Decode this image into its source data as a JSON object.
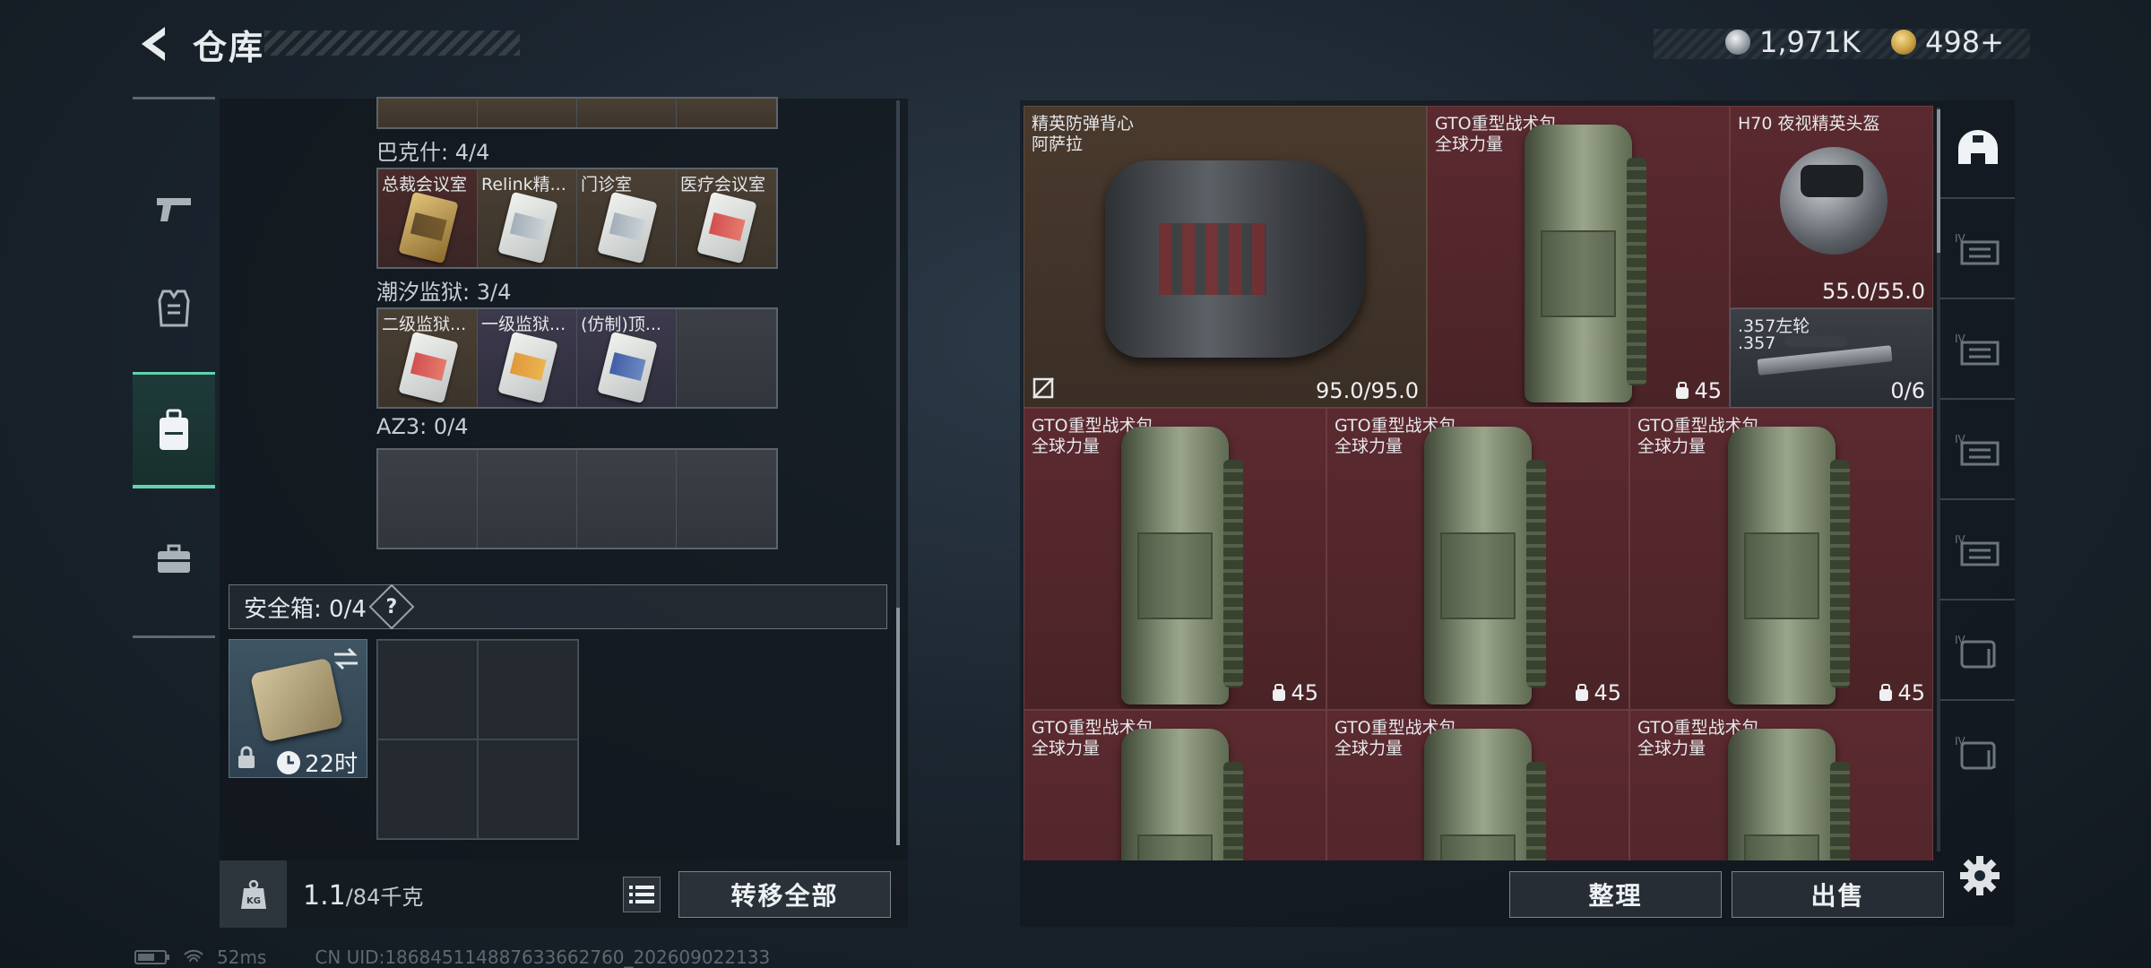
{
  "header": {
    "title": "仓库"
  },
  "currency": [
    {
      "icon": "silver-coin-icon",
      "amount": "1,971K"
    },
    {
      "icon": "gold-coin-icon",
      "amount": "498+"
    }
  ],
  "left_nav": [
    {
      "name": "weapons",
      "icon": "pistol-icon",
      "active": false
    },
    {
      "name": "gear",
      "icon": "armor-vest-icon",
      "active": false
    },
    {
      "name": "containers",
      "icon": "backpack-icon",
      "active": true
    },
    {
      "name": "supplies",
      "icon": "briefcase-icon",
      "active": false
    }
  ],
  "key_groups": [
    {
      "label": "巴克什: 4/4",
      "slots": [
        {
          "label": "总裁会议室",
          "style": "red",
          "card": "gold"
        },
        {
          "label": "Relink精...",
          "style": "tan",
          "card": "white"
        },
        {
          "label": "门诊室",
          "style": "tan",
          "card": "white"
        },
        {
          "label": "医疗会议室",
          "style": "tan",
          "card": "red"
        }
      ]
    },
    {
      "label": "潮汐监狱: 3/4",
      "slots": [
        {
          "label": "二级监狱...",
          "style": "tan",
          "card": "red"
        },
        {
          "label": "一级监狱...",
          "style": "purple",
          "card": "orange"
        },
        {
          "label": "(仿制)顶...",
          "style": "purple",
          "card": "blue"
        },
        {
          "label": "",
          "style": "grey",
          "card": ""
        }
      ]
    },
    {
      "label": "AZ3: 0/4",
      "slots": [
        {
          "label": "",
          "style": "grey",
          "card": ""
        },
        {
          "label": "",
          "style": "grey",
          "card": ""
        },
        {
          "label": "",
          "style": "grey",
          "card": ""
        },
        {
          "label": "",
          "style": "grey",
          "card": ""
        }
      ]
    }
  ],
  "safe_box": {
    "label": "安全箱: 0/4",
    "help": "?",
    "timer": "22时"
  },
  "capacity": {
    "current": "1.1",
    "max": "/84千克"
  },
  "transfer_label": "转移全部",
  "stash_items": [
    {
      "name1": "精英防弹背心",
      "name2": "阿萨拉",
      "value": "95.0/95.0",
      "style": "brown",
      "kind": "vest"
    },
    {
      "name1": "GTO重型战术包",
      "name2": "全球力量",
      "value": "45",
      "style": "red",
      "kind": "pack"
    },
    {
      "name1": "H70 夜视精英头盔",
      "name2": "",
      "value": "55.0/55.0",
      "style": "red",
      "kind": "helmet"
    },
    {
      "name1": ".357左轮",
      "name2": ".357",
      "value": "0/6",
      "style": "dark",
      "kind": "gun"
    },
    {
      "name1": "GTO重型战术包",
      "name2": "全球力量",
      "value": "45",
      "style": "red",
      "kind": "pack"
    },
    {
      "name1": "GTO重型战术包",
      "name2": "全球力量",
      "value": "45",
      "style": "red",
      "kind": "pack"
    },
    {
      "name1": "GTO重型战术包",
      "name2": "全球力量",
      "value": "45",
      "style": "red",
      "kind": "pack"
    },
    {
      "name1": "GTO重型战术包",
      "name2": "全球力量",
      "value": "",
      "style": "red",
      "kind": "pack"
    },
    {
      "name1": "GTO重型战术包",
      "name2": "全球力量",
      "value": "",
      "style": "red",
      "kind": "pack"
    },
    {
      "name1": "GTO重型战术包",
      "name2": "全球力量",
      "value": "",
      "style": "red",
      "kind": "pack"
    }
  ],
  "buttons": {
    "sort": "整理",
    "sell": "出售"
  },
  "right_sidebar_icons": [
    "helmet-slot-icon",
    "armor-slot-icon",
    "armor-slot-icon",
    "armor-slot-icon",
    "armor-slot-icon",
    "backpack-slot-icon",
    "backpack-slot-icon"
  ],
  "status": {
    "ping": "52ms",
    "uid": "CN UID:18684511488763366276​0_202609022133"
  },
  "colors": {
    "accent": "#5fd3b0",
    "item_red": "#5b2a30",
    "item_brown": "#4a3a2e"
  }
}
